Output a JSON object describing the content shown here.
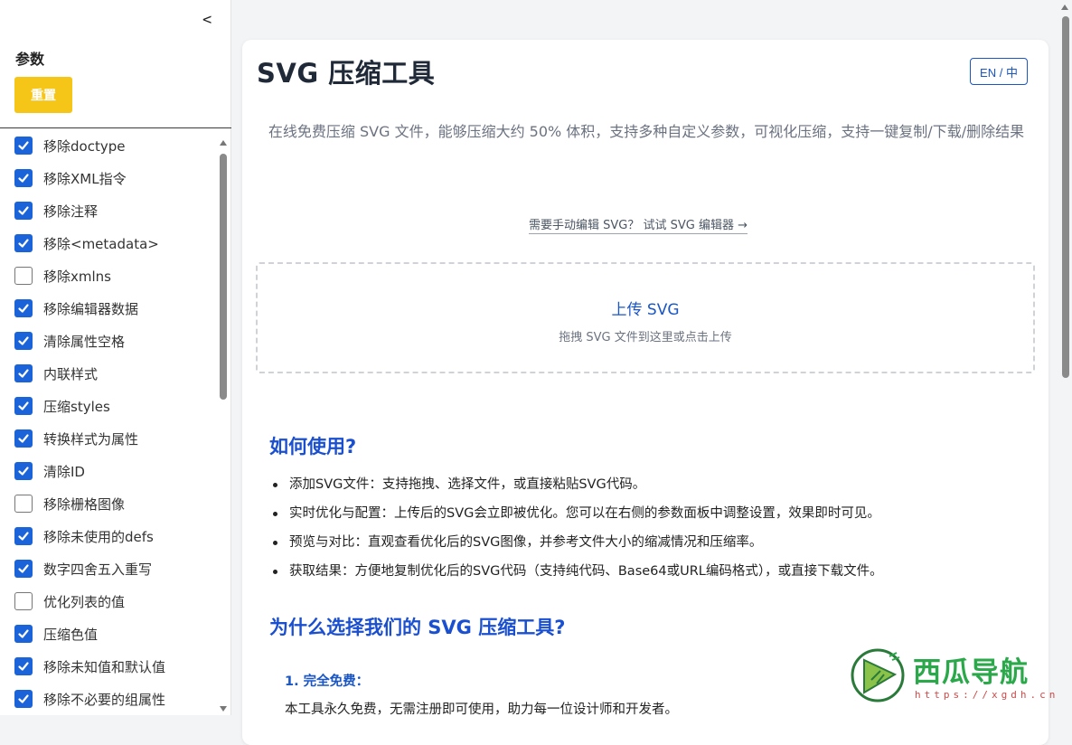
{
  "sidebar": {
    "collapse_label": "<",
    "title": "参数",
    "reset_label": "重置",
    "options": [
      {
        "label": "移除doctype",
        "checked": true
      },
      {
        "label": "移除XML指令",
        "checked": true
      },
      {
        "label": "移除注释",
        "checked": true
      },
      {
        "label": "移除<metadata>",
        "checked": true
      },
      {
        "label": "移除xmlns",
        "checked": false
      },
      {
        "label": "移除编辑器数据",
        "checked": true
      },
      {
        "label": "清除属性空格",
        "checked": true
      },
      {
        "label": "内联样式",
        "checked": true
      },
      {
        "label": "压缩styles",
        "checked": true
      },
      {
        "label": "转换样式为属性",
        "checked": true
      },
      {
        "label": "清除ID",
        "checked": true
      },
      {
        "label": "移除栅格图像",
        "checked": false
      },
      {
        "label": "移除未使用的defs",
        "checked": true
      },
      {
        "label": "数字四舍五入重写",
        "checked": true
      },
      {
        "label": "优化列表的值",
        "checked": false
      },
      {
        "label": "压缩色值",
        "checked": true
      },
      {
        "label": "移除未知值和默认值",
        "checked": true
      },
      {
        "label": "移除不必要的组属性",
        "checked": true
      }
    ]
  },
  "header": {
    "title": "SVG 压缩工具",
    "lang_toggle": "EN / 中"
  },
  "intro": {
    "description": "在线免费压缩 SVG 文件，能够压缩大约 50% 体积，支持多种自定义参数，可视化压缩，支持一键复制/下载/删除结果",
    "editor_link": "需要手动编辑 SVG？ 试试 SVG 编辑器 →"
  },
  "upload": {
    "title": "上传 SVG",
    "hint": "拖拽 SVG 文件到这里或点击上传"
  },
  "how_to": {
    "heading": "如何使用?",
    "items": [
      "添加SVG文件：支持拖拽、选择文件，或直接粘贴SVG代码。",
      "实时优化与配置：上传后的SVG会立即被优化。您可以在右侧的参数面板中调整设置，效果即时可见。",
      "预览与对比：直观查看优化后的SVG图像，并参考文件大小的缩减情况和压缩率。",
      "获取结果：方便地复制优化后的SVG代码（支持纯代码、Base64或URL编码格式），或直接下载文件。"
    ]
  },
  "why": {
    "heading": "为什么选择我们的 SVG 压缩工具?",
    "feature_title": "1. 完全免费：",
    "feature_desc": "本工具永久免费，无需注册即可使用，助力每一位设计师和开发者。"
  },
  "watermark": {
    "brand": "西瓜导航",
    "url": "https://xgdh.cn"
  },
  "colors": {
    "accent_blue": "#1a56c4",
    "checkbox_blue": "#1a63d8",
    "reset_yellow": "#f5c518",
    "watermark_green": "#2aa84a"
  }
}
